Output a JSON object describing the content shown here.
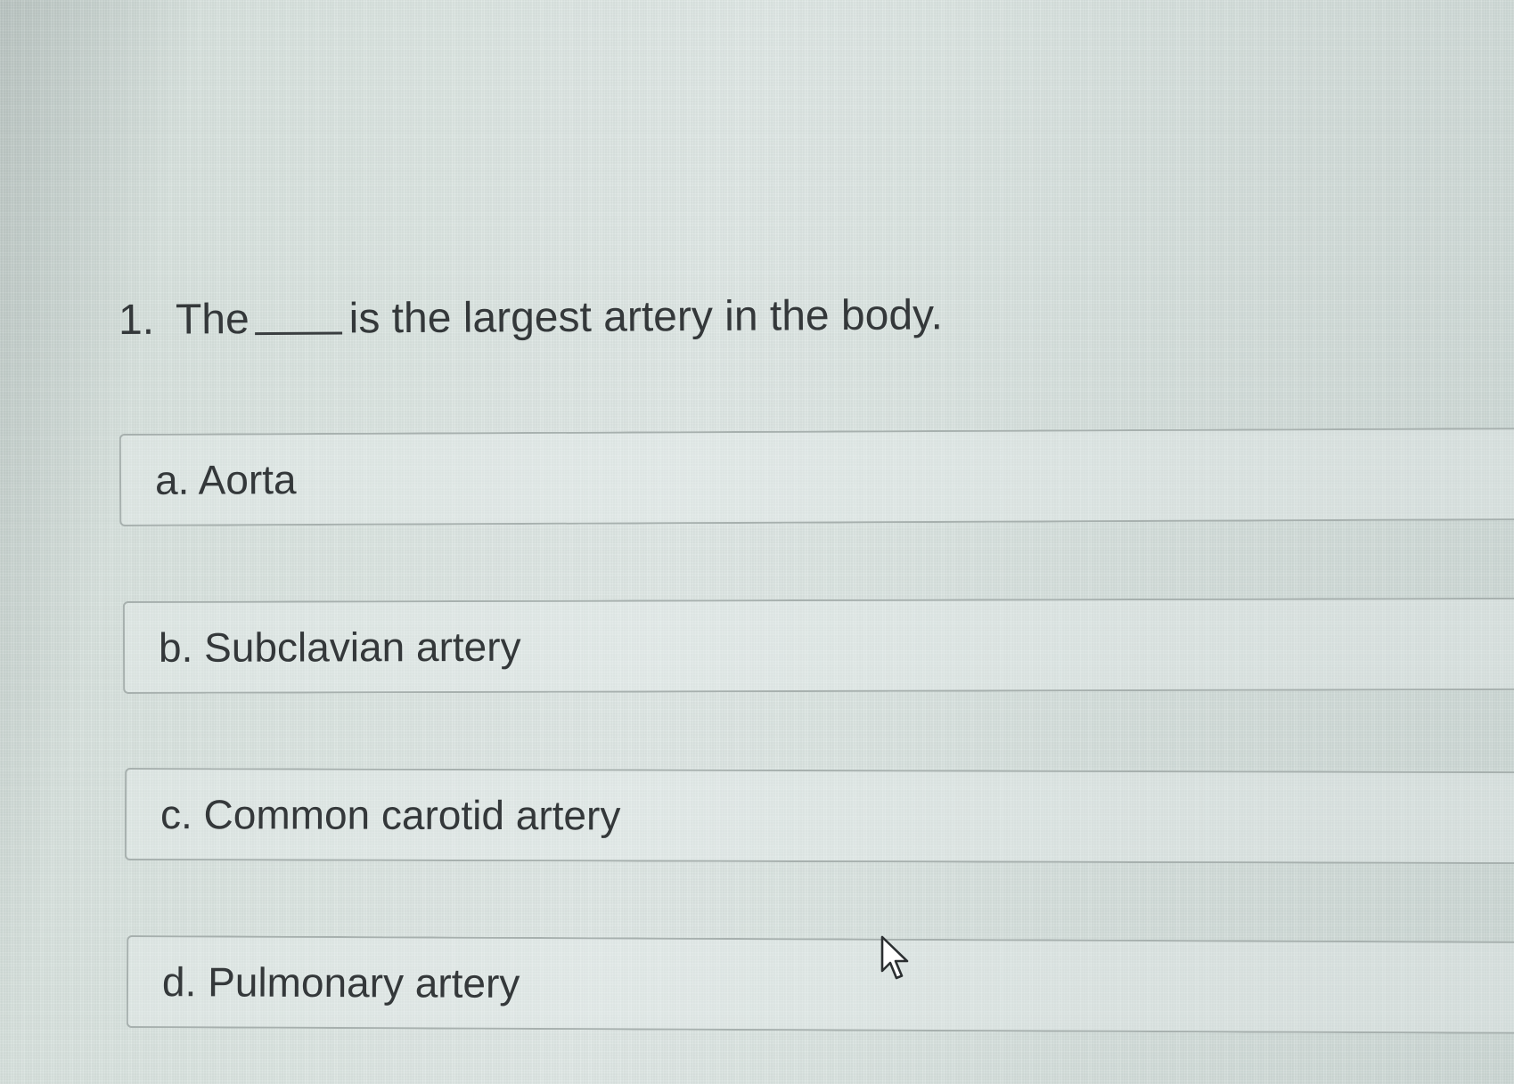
{
  "question": {
    "number": "1.",
    "prefix": "The",
    "suffix": "is the largest artery in the body."
  },
  "options": [
    {
      "label": "a. Aorta"
    },
    {
      "label": "b. Subclavian artery"
    },
    {
      "label": "c. Common carotid artery"
    },
    {
      "label": "d. Pulmonary artery"
    }
  ],
  "icons": {
    "cursor": "mouse-pointer-icon"
  }
}
